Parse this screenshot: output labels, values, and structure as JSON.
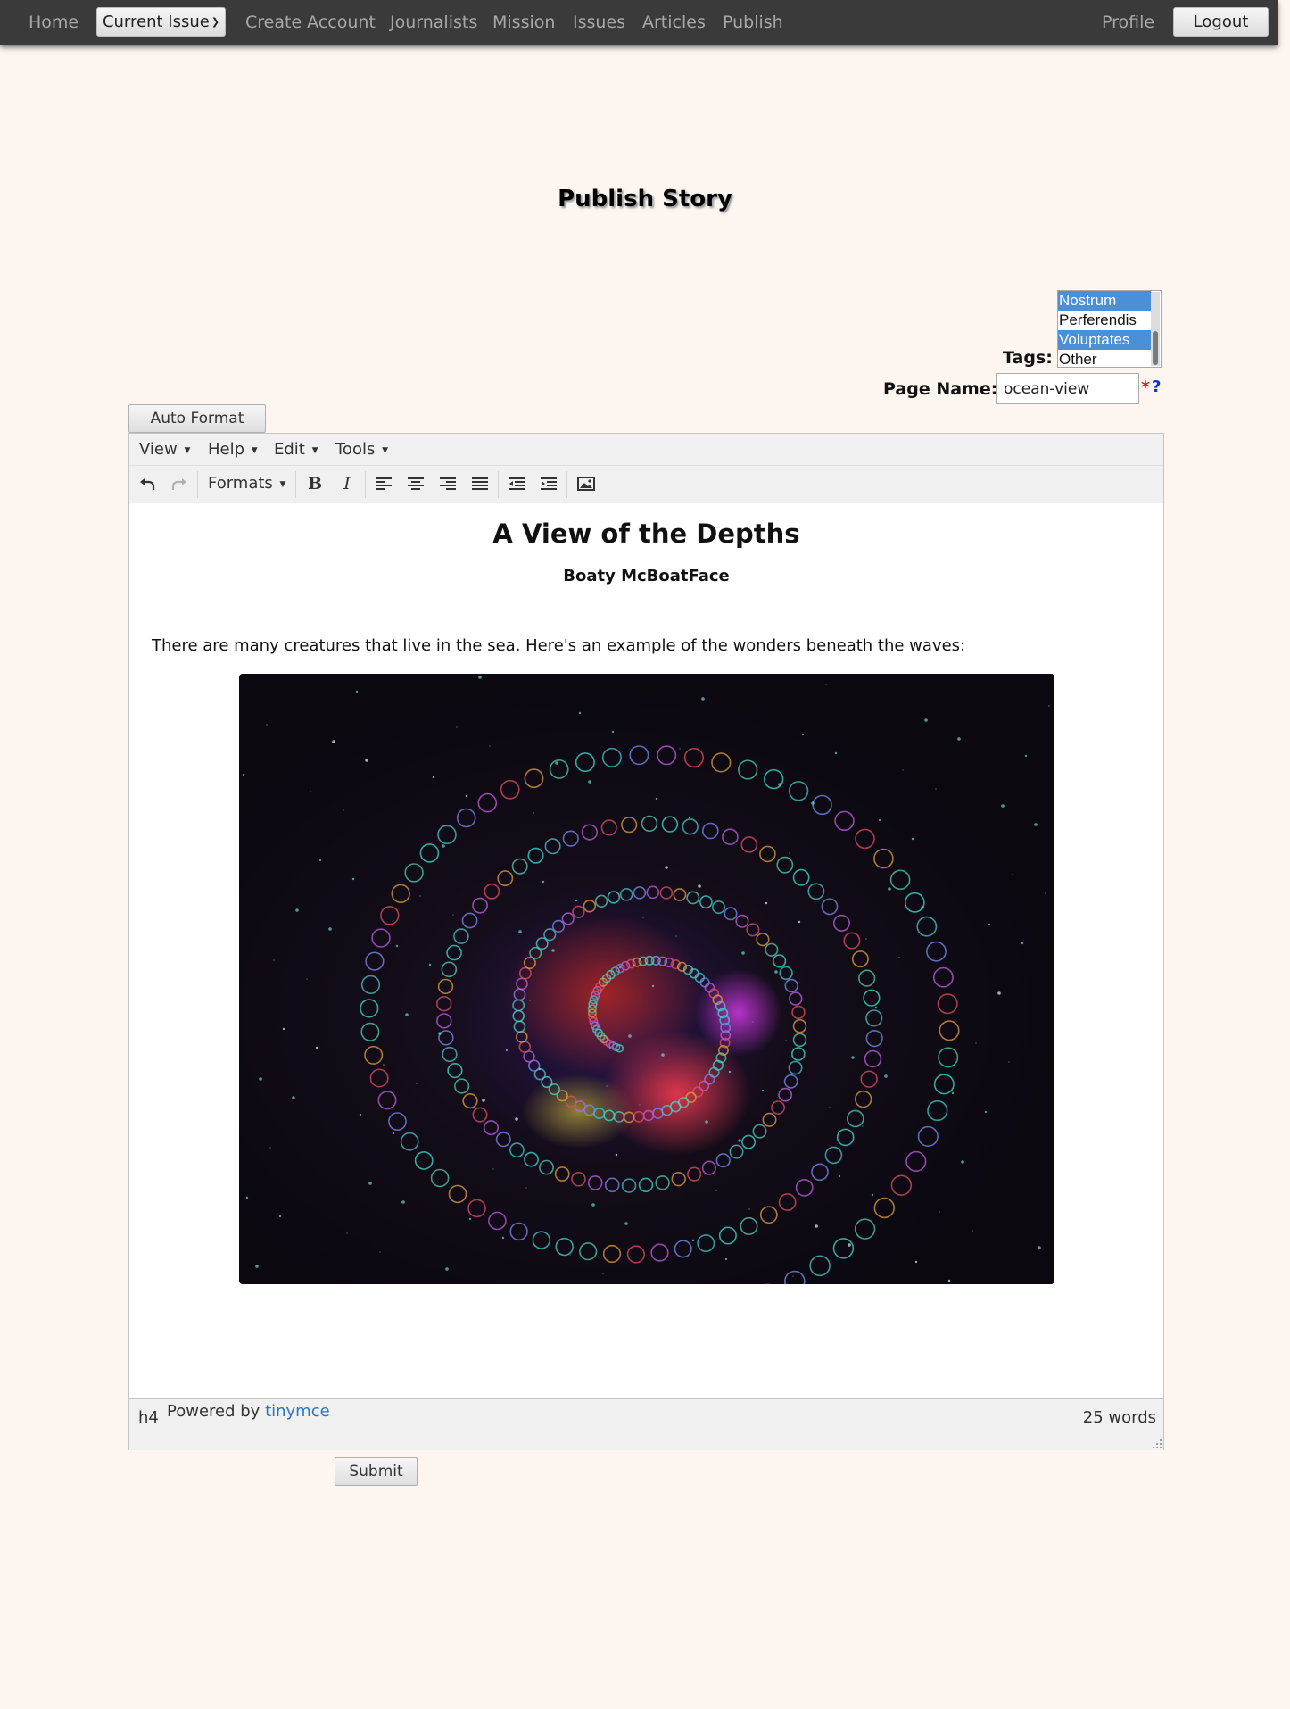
{
  "nav": {
    "home": "Home",
    "current_issue": "Current Issue",
    "create_account": "Create Account",
    "journalists": "Journalists",
    "mission": "Mission",
    "issues": "Issues",
    "articles": "Articles",
    "publish": "Publish",
    "profile": "Profile",
    "logout": "Logout"
  },
  "page": {
    "title": "Publish Story"
  },
  "form": {
    "tags_label": "Tags:",
    "tags": [
      {
        "label": "Nostrum",
        "selected": true
      },
      {
        "label": "Perferendis",
        "selected": false
      },
      {
        "label": "Voluptates",
        "selected": true
      },
      {
        "label": "Other",
        "selected": false
      }
    ],
    "page_name_label": "Page Name:",
    "page_name_value": "ocean-view",
    "required_mark": "*",
    "help_mark": "?",
    "auto_format": "Auto Format",
    "submit": "Submit"
  },
  "editor": {
    "menu": [
      "View",
      "Help",
      "Edit",
      "Tools"
    ],
    "toolbar": {
      "formats": "Formats",
      "icons": [
        "undo-icon",
        "redo-icon",
        "bold-icon",
        "italic-icon",
        "align-left-icon",
        "align-center-icon",
        "align-right-icon",
        "align-justify-icon",
        "outdent-icon",
        "indent-icon",
        "image-icon"
      ]
    },
    "content": {
      "title": "A View of the Depths",
      "author": "Boaty McBoatFace",
      "paragraph": "There are many creatures that live in the sea. Here's an example of the wonders beneath the waves:"
    },
    "status": {
      "path": "h4",
      "powered_by": "Powered by ",
      "powered_link": "tinymce",
      "word_count": "25 words"
    }
  },
  "colors": {
    "page_bg": "#fdf5ef",
    "navbar_bg": "#3a3a3a",
    "selected_tag": "#4a90d9",
    "link": "#2a76c6",
    "required": "#e02020",
    "help": "#1030d8"
  }
}
